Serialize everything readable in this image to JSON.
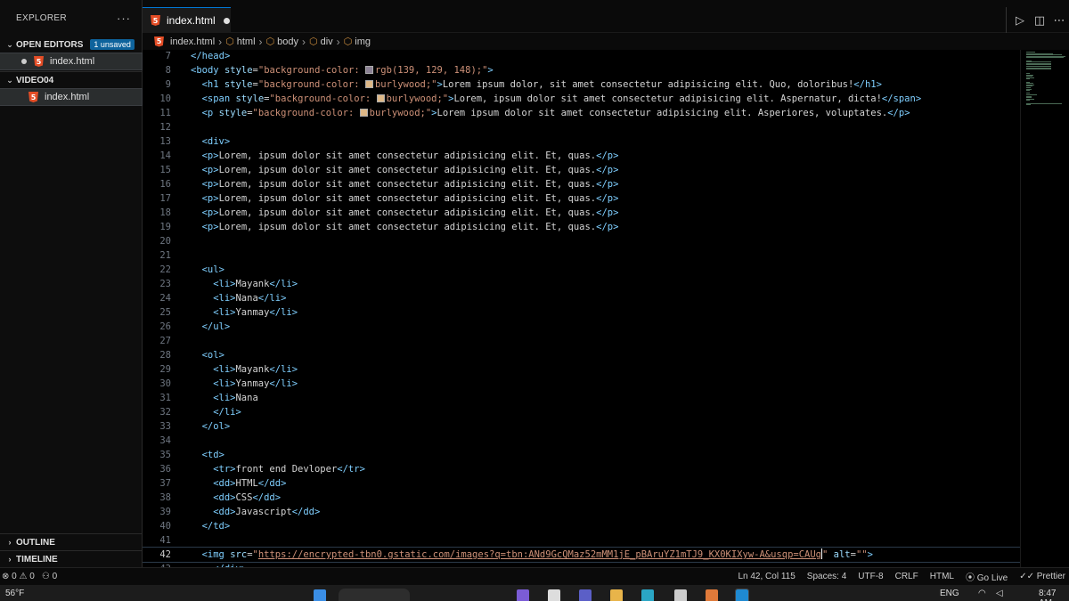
{
  "sidebar": {
    "title": "EXPLORER",
    "more_glyph": "···",
    "open_editors": {
      "label": "OPEN EDITORS",
      "badge": "1 unsaved",
      "files": [
        {
          "name": "index.html"
        }
      ]
    },
    "folder": {
      "label": "VIDEO04",
      "files": [
        {
          "name": "index.html"
        }
      ]
    },
    "outline_label": "OUTLINE",
    "timeline_label": "TIMELINE"
  },
  "tab": {
    "name": "index.html"
  },
  "breadcrumbs": [
    "index.html",
    "html",
    "body",
    "div",
    "img"
  ],
  "swatch_colors": {
    "bg1": "#8b8194",
    "burlywood": "#deb887"
  },
  "code": {
    "lines": [
      {
        "n": "7",
        "text": "</head>"
      },
      {
        "n": "8",
        "text": "<body style=\"background-color: rgb(139, 129, 148);\">"
      },
      {
        "n": "9",
        "text": "<h1 style=\"background-color: burlywood;\">Lorem ipsum dolor, sit amet consectetur adipisicing elit. Quo, doloribus!</h1>"
      },
      {
        "n": "10",
        "text": "<span style=\"background-color: burlywood;\">Lorem, ipsum dolor sit amet consectetur adipisicing elit. Aspernatur, dicta!</span>"
      },
      {
        "n": "11",
        "text": "<p style=\"background-color: burlywood;\">Lorem ipsum dolor sit amet consectetur adipisicing elit. Asperiores, voluptates.</p>"
      },
      {
        "n": "12",
        "text": ""
      },
      {
        "n": "13",
        "text": "<div>"
      },
      {
        "n": "14",
        "text": "<p>Lorem, ipsum dolor sit amet consectetur adipisicing elit. Et, quas.</p>"
      },
      {
        "n": "15",
        "text": "<p>Lorem, ipsum dolor sit amet consectetur adipisicing elit. Et, quas.</p>"
      },
      {
        "n": "16",
        "text": "<p>Lorem, ipsum dolor sit amet consectetur adipisicing elit. Et, quas.</p>"
      },
      {
        "n": "17",
        "text": "<p>Lorem, ipsum dolor sit amet consectetur adipisicing elit. Et, quas.</p>"
      },
      {
        "n": "18",
        "text": "<p>Lorem, ipsum dolor sit amet consectetur adipisicing elit. Et, quas.</p>"
      },
      {
        "n": "19",
        "text": "<p>Lorem, ipsum dolor sit amet consectetur adipisicing elit. Et, quas.</p>"
      },
      {
        "n": "20",
        "text": ""
      },
      {
        "n": "21",
        "text": ""
      },
      {
        "n": "22",
        "text": "<ul>"
      },
      {
        "n": "23",
        "text": "<li>Mayank</li>"
      },
      {
        "n": "24",
        "text": "<li>Nana</li>"
      },
      {
        "n": "25",
        "text": "<li>Yanmay</li>"
      },
      {
        "n": "26",
        "text": "</ul>"
      },
      {
        "n": "27",
        "text": ""
      },
      {
        "n": "28",
        "text": "<ol>"
      },
      {
        "n": "29",
        "text": "<li>Mayank</li>"
      },
      {
        "n": "30",
        "text": "<li>Yanmay</li>"
      },
      {
        "n": "31",
        "text": "<li>Nana"
      },
      {
        "n": "32",
        "text": "</li>"
      },
      {
        "n": "33",
        "text": "</ol>"
      },
      {
        "n": "34",
        "text": ""
      },
      {
        "n": "35",
        "text": "<td>"
      },
      {
        "n": "36",
        "text": "<tr>front end Devloper</tr>"
      },
      {
        "n": "37",
        "text": "<dd>HTML</dd>"
      },
      {
        "n": "38",
        "text": "<dd>CSS</dd>"
      },
      {
        "n": "39",
        "text": "<dd>Javascript</dd>"
      },
      {
        "n": "40",
        "text": "</td>"
      },
      {
        "n": "41",
        "text": ""
      },
      {
        "n": "42",
        "text": "<img src=\"https://encrypted-tbn0.gstatic.com/images?q=tbn:ANd9GcQMaz52mMM1jE_pBAruYZ1mTJ9_KX0KIXyw-A&usqp=CAUg\" alt=\"\">"
      },
      {
        "n": "43",
        "text": "</div>"
      }
    ]
  },
  "status": {
    "problems": "0",
    "warnings": "0",
    "ports": "0",
    "position": "Ln 42, Col 115",
    "spaces": "Spaces: 4",
    "encoding": "UTF-8",
    "eol": "CRLF",
    "language": "HTML",
    "golive": "Go Live",
    "prettier": "Prettier"
  },
  "taskbar": {
    "temperature": "56°F",
    "language": "ENG",
    "time": "8:47 AM"
  }
}
